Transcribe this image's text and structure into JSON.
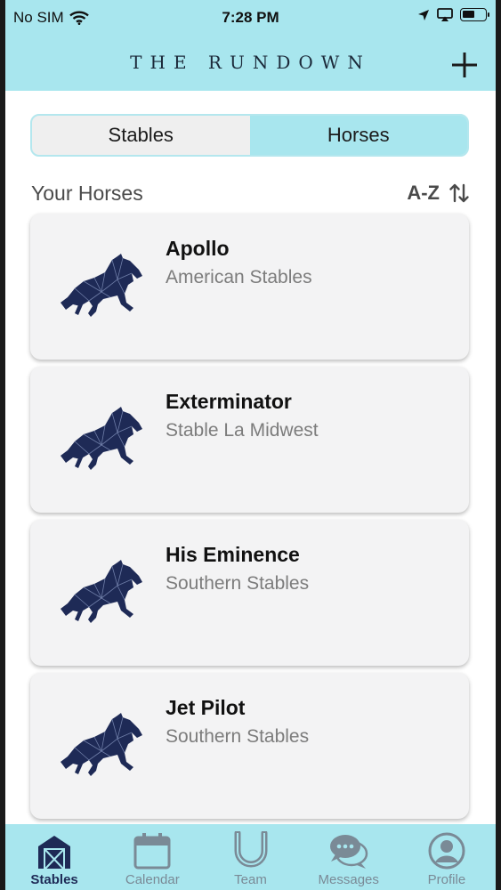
{
  "status_bar": {
    "carrier": "No SIM",
    "time": "7:28 PM",
    "battery_level": 0.55
  },
  "header": {
    "title": "THE RUNDOWN",
    "add_icon": "plus-icon"
  },
  "segment": {
    "options": [
      "Stables",
      "Horses"
    ],
    "selected": "Horses"
  },
  "list": {
    "title": "Your Horses",
    "sort_label": "A-Z",
    "sort_icon": "sort-arrows-icon"
  },
  "horses": [
    {
      "name": "Apollo",
      "stable": "American Stables"
    },
    {
      "name": "Exterminator",
      "stable": "Stable La Midwest"
    },
    {
      "name": "His Eminence",
      "stable": "Southern Stables"
    },
    {
      "name": "Jet Pilot",
      "stable": "Southern Stables"
    }
  ],
  "tabs": [
    {
      "label": "Stables",
      "icon": "barn-icon",
      "active": true
    },
    {
      "label": "Calendar",
      "icon": "calendar-icon",
      "active": false
    },
    {
      "label": "Team",
      "icon": "horseshoe-icon",
      "active": false
    },
    {
      "label": "Messages",
      "icon": "chat-bubbles-icon",
      "active": false
    },
    {
      "label": "Profile",
      "icon": "person-icon",
      "active": false
    }
  ],
  "colors": {
    "accent": "#a8e6ee",
    "navy": "#1e2a56",
    "card": "#f3f3f4"
  }
}
